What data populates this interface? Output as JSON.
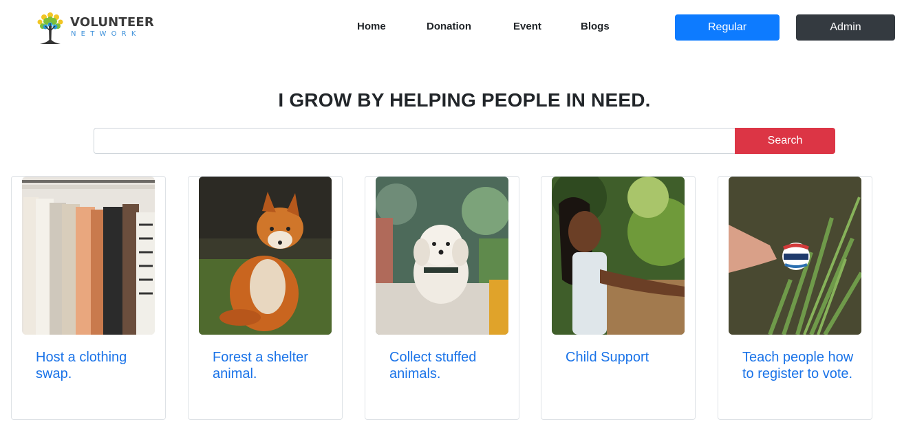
{
  "brand": {
    "title": "VOLUNTEER",
    "subtitle": "NETWORK"
  },
  "nav": {
    "links": [
      {
        "label": "Home"
      },
      {
        "label": "Donation"
      },
      {
        "label": "Event"
      },
      {
        "label": "Blogs"
      }
    ],
    "regular_label": "Regular",
    "admin_label": "Admin"
  },
  "hero": {
    "title": "I GROW BY HELPING PEOPLE IN NEED.",
    "search_button": "Search",
    "search_value": ""
  },
  "cards": [
    {
      "title": "Host a clothing swap."
    },
    {
      "title": "Forest a shelter animal."
    },
    {
      "title": "Collect stuffed animals."
    },
    {
      "title": "Child Support"
    },
    {
      "title": "Teach people how to register to vote."
    }
  ],
  "colors": {
    "primary": "#0d7bff",
    "dark": "#343a40",
    "danger": "#dc3545",
    "link": "#1a73e8"
  },
  "icons": {
    "brand_logo": "tree-logo-icon"
  }
}
